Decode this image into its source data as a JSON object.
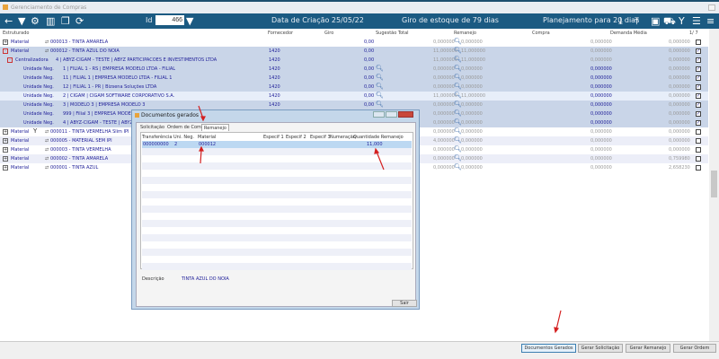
{
  "window": {
    "title": "Gerenciamento de Compras"
  },
  "toolbar": {
    "id_label": "Id",
    "id_value": "466",
    "creation_date": "Data de Criação 25/05/22",
    "stock_turnover": "Giro de estoque de  79 dias",
    "planning": "Planejamento para 20 dias",
    "left_icons": [
      "back-arrow-icon",
      "filter-icon",
      "gear-icon",
      "chart-icon",
      "copy-icon",
      "refresh-icon"
    ],
    "right_icons": [
      "download-icon",
      "upload-icon",
      "clipboard-icon",
      "truck-icon",
      "merge-icon",
      "checklist-icon",
      "menu-icon"
    ]
  },
  "columns": {
    "structured": "Estruturado",
    "supplier": "Fornecedor",
    "turnover": "Giro",
    "suggestion": "Sugestão Total",
    "reallocation": "Remanejo",
    "purchase": "Compra",
    "avg_demand": "Demanda Média",
    "page": "1/ 7"
  },
  "rows": [
    {
      "expander": "+",
      "type": "Material",
      "code": "000013 - TINTA AMARELA",
      "supplier": "",
      "sug": "0,00",
      "rem": "0,000000",
      "rem2": "0,000000",
      "compra": "0,000000",
      "dem": "0,000000",
      "checked": false,
      "style": "white"
    },
    {
      "expander": "-",
      "type": "Material",
      "code": "000012 - TINTA AZUL DO NOIA",
      "supplier": "1420",
      "sug": "0,00",
      "rem": "11,000000",
      "rem2": "11,000000",
      "compra": "0,000000",
      "dem": "0,000000",
      "checked": true,
      "style": "sel"
    },
    {
      "expander": "-",
      "type": "Centralizadora",
      "code": "4  | ABYZ-CIGAM - TESTE | ABYZ PARTICIPACOES E INVESTIMENTOS LTDA",
      "supplier": "1420",
      "sug": "0,00",
      "rem": "11,000000",
      "rem2": "11,000000",
      "compra": "0,000000",
      "dem": "0,000000",
      "checked": true,
      "style": "sel"
    },
    {
      "type": "Unidade Neg.",
      "code": "1 | FILIAL 1 - RS | EMPRESA MODELO LTDA - FILIAL",
      "supplier": "1420",
      "sug": "0,00",
      "rem": "0,000000",
      "rem2": "0,000000",
      "compra": "0,000000",
      "dem": "0,000000",
      "checked": true,
      "style": "sel",
      "mag": true
    },
    {
      "type": "Unidade Neg.",
      "code": "11 | FILIAL 1 | EMPRESA MODELO LTDA - FILIAL 1",
      "supplier": "1420",
      "sug": "0,00",
      "rem": "0,000000",
      "rem2": "0,000000",
      "compra": "0,000000",
      "dem": "0,000000",
      "checked": true,
      "style": "sel",
      "mag": true
    },
    {
      "type": "Unidade Neg.",
      "code": "12 | FILIAL 1 - PR | Bizsena Soluções LTDA",
      "supplier": "1420",
      "sug": "0,00",
      "rem": "0,000000",
      "rem2": "0,000000",
      "compra": "0,000000",
      "dem": "0,000000",
      "checked": true,
      "style": "sel",
      "mag": true
    },
    {
      "type": "Unidade Neg.",
      "code": "2 | CIGAM | CIGAM SOFTWARE CORPORATIVO S.A.",
      "supplier": "1420",
      "sug": "0,00",
      "rem": "11,000000",
      "rem2": "11,000000",
      "compra": "0,000000",
      "dem": "0,000000",
      "checked": true,
      "style": "hl",
      "mag": true
    },
    {
      "type": "Unidade Neg.",
      "code": "3 | MODELO 3 | EMPRESA MODELO 3",
      "supplier": "1420",
      "sug": "0,00",
      "rem": "0,000000",
      "rem2": "0,000000",
      "compra": "0,000000",
      "dem": "0,000000",
      "checked": true,
      "style": "sel",
      "mag": true
    },
    {
      "type": "Unidade Neg.",
      "code": "999 | Filial 3 | EMPRESA MODELO 3",
      "supplier": "1420",
      "sug": "0,00",
      "rem": "0,000000",
      "rem2": "0,000000",
      "compra": "0,000000",
      "dem": "0,000000",
      "checked": true,
      "style": "sel",
      "mag": true
    },
    {
      "type": "Unidade Neg.",
      "code": "4 | ABYZ-CIGAM - TESTE | ABYZ PAR",
      "supplier": "1420",
      "sug": "0,00",
      "rem": "0,000000",
      "rem2": "0,000000",
      "compra": "0,000000",
      "dem": "0,000000",
      "checked": true,
      "style": "sel",
      "mag": true
    },
    {
      "expander": "+",
      "type": "Material",
      "fork": true,
      "code": "000011 - TINTA VERMELHA Slim IPI",
      "supplier": "",
      "sug": "",
      "rem": "0,000000",
      "rem2": "0,000000",
      "compra": "0,000000",
      "dem": "0,000000",
      "checked": false,
      "style": "white"
    },
    {
      "expander": "+",
      "type": "Material",
      "code": "000005 - MATERIAL SEM IPI",
      "supplier": "",
      "sug": "",
      "rem": "4,000000",
      "rem2": "0,000000",
      "compra": "0,000000",
      "dem": "0,000000",
      "checked": false,
      "style": "alt"
    },
    {
      "expander": "+",
      "type": "Material",
      "code": "000003 - TINTA VERMELHA",
      "supplier": "",
      "sug": "",
      "rem": "0,000000",
      "rem2": "0,000000",
      "compra": "0,000000",
      "dem": "0,000000",
      "checked": false,
      "style": "white"
    },
    {
      "expander": "+",
      "type": "Material",
      "code": "000002 - TINTA AMARELA",
      "supplier": "",
      "sug": "",
      "rem": "0,000000",
      "rem2": "0,000000",
      "compra": "0,000000",
      "dem": "0,759980",
      "checked": false,
      "style": "alt"
    },
    {
      "expander": "+",
      "type": "Material",
      "code": "000001 - TINTA AZUL",
      "supplier": "",
      "sug": "",
      "rem": "0,000000",
      "rem2": "0,000000",
      "compra": "0,000000",
      "dem": "2,658230",
      "checked": false,
      "style": "white"
    }
  ],
  "dialog": {
    "title": "Documentos gerados",
    "tabs": [
      "Solicitação",
      "Ordem de Compra",
      "Remanejo"
    ],
    "active_tab": "Remanejo",
    "headers": [
      "Transferência",
      "Uni. Neg.",
      "Material",
      "Especif 1",
      "Especif 2",
      "Especif 3",
      "Numeração",
      "Quantidade Remanejo"
    ],
    "rows": [
      {
        "transfer": "000000000",
        "unit": "2",
        "material": "000012",
        "qty": "11,000"
      }
    ],
    "description_label": "Descrição",
    "description_value": "TINTA AZUL DO NOIA",
    "close_button": "Sair"
  },
  "buttons": {
    "docs": "Documentos Gerados",
    "solicit": "Gerar Solicitação",
    "remanejo": "Gerar Remanejo",
    "ordem": "Gerar Ordem"
  },
  "colors": {
    "toolbar": "#1b5a82",
    "selected_row": "#c9d5e8",
    "annotation_arrow": "#d42020"
  }
}
